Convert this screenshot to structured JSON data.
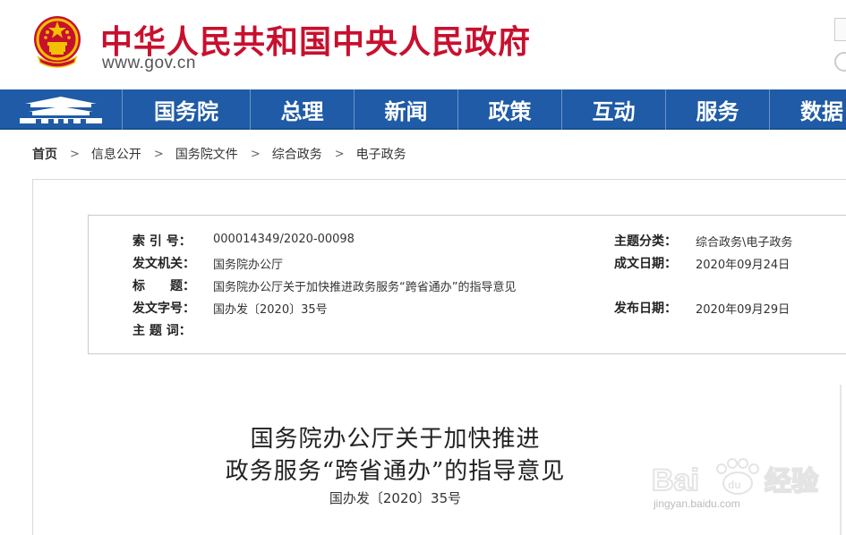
{
  "header": {
    "site_title": "中华人民共和国中央人民政府",
    "site_url": "www.gov.cn"
  },
  "nav": {
    "items": [
      {
        "label": "国务院"
      },
      {
        "label": "总理"
      },
      {
        "label": "新闻"
      },
      {
        "label": "政策"
      },
      {
        "label": "互动"
      },
      {
        "label": "服务"
      },
      {
        "label": "数据"
      }
    ]
  },
  "breadcrumb": {
    "items": [
      {
        "label": "首页"
      },
      {
        "label": "信息公开"
      },
      {
        "label": "国务院文件"
      },
      {
        "label": "综合政务"
      },
      {
        "label": "电子政务"
      }
    ],
    "separator": ">"
  },
  "meta": {
    "index_no_label": "索 引 号：",
    "index_no": "000014349/2020-00098",
    "topic_label": "主题分类：",
    "topic": "综合政务\\电子政务",
    "issuer_label": "发文机关：",
    "issuer": "国务院办公厅",
    "written_date_label": "成文日期：",
    "written_date": "2020年09月24日",
    "title_label": "标　　题：",
    "title": "国务院办公厅关于加快推进政务服务“跨省通办”的指导意见",
    "doc_no_label": "发文字号：",
    "doc_no": "国办发〔2020〕35号",
    "publish_date_label": "发布日期：",
    "publish_date": "2020年09月29日",
    "keywords_label": "主 题 词：",
    "keywords": ""
  },
  "document": {
    "title_line1": "国务院办公厅关于加快推进",
    "title_line2": "政务服务“跨省通办”的指导意见",
    "number": "国办发〔2020〕35号"
  },
  "watermark": {
    "brand": "Baidu经验",
    "url": "jingyan.baidu.com"
  },
  "colors": {
    "brand_red": "#c8102e",
    "nav_blue": "#1f5ba6"
  }
}
